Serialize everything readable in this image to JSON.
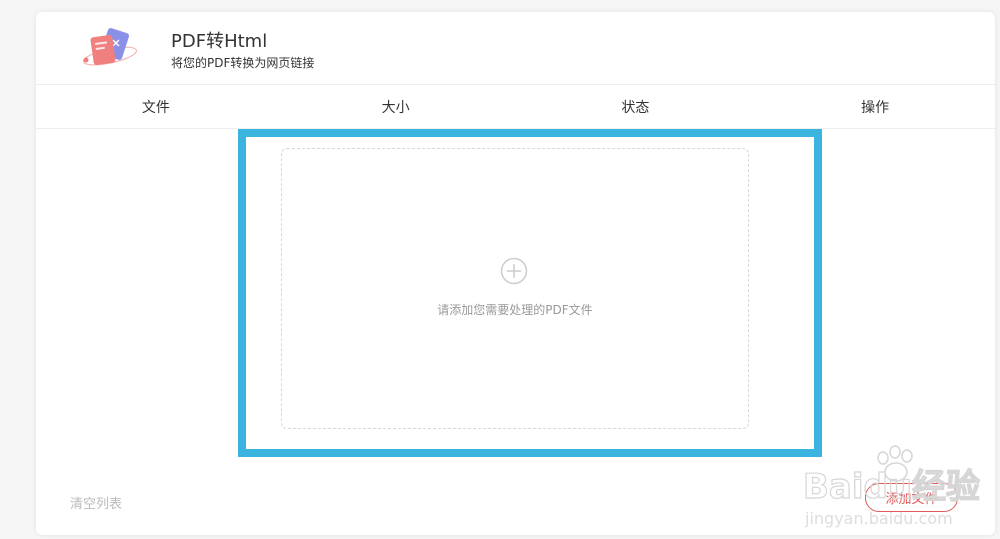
{
  "app": {
    "title": "PDF转Html",
    "subtitle": "将您的PDF转换为网页链接",
    "logo_icon": "pdf-convert-logo-icon"
  },
  "table": {
    "columns": [
      "文件",
      "大小",
      "状态",
      "操作"
    ]
  },
  "dropzone": {
    "icon": "plus-circle-icon",
    "text": "请添加您需要处理的PDF文件"
  },
  "footer": {
    "clear_label": "清空列表",
    "add_label": "添加文件"
  },
  "watermark": {
    "brand": "Baidu经验",
    "url": "jingyan.baidu.com"
  },
  "colors": {
    "highlight": "#3bb5e0",
    "accent": "#e25a5a",
    "logo_red": "#f08080",
    "logo_blue": "#8a8fe8"
  }
}
